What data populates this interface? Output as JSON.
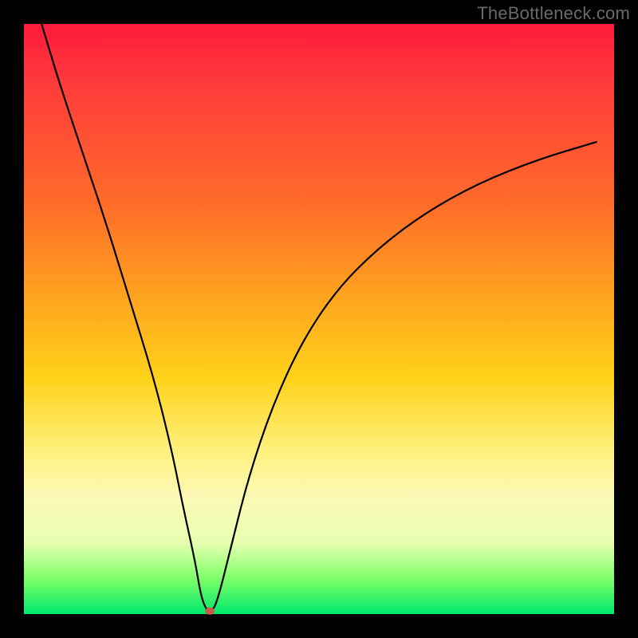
{
  "watermark": "TheBottleneck.com",
  "chart_data": {
    "type": "line",
    "title": "",
    "xlabel": "",
    "ylabel": "",
    "xlim": [
      0,
      100
    ],
    "ylim": [
      0,
      100
    ],
    "series": [
      {
        "name": "curve",
        "x": [
          3,
          6,
          10,
          14,
          18,
          22,
          25,
          27,
          29,
          30,
          31,
          32,
          33,
          35,
          38,
          42,
          47,
          53,
          60,
          68,
          77,
          87,
          97
        ],
        "y": [
          100,
          90,
          78,
          66,
          53,
          40,
          28,
          18,
          9,
          3,
          0.5,
          0.5,
          3,
          11,
          23,
          35,
          46,
          55,
          62,
          68,
          73,
          77,
          80
        ]
      }
    ],
    "marker": {
      "x": 31.5,
      "y": 0.5,
      "color": "#c95a4a"
    },
    "gradient_stops": [
      {
        "pos": 0,
        "color": "#ff1a3c"
      },
      {
        "pos": 30,
        "color": "#ff6a2a"
      },
      {
        "pos": 60,
        "color": "#ffd21a"
      },
      {
        "pos": 80,
        "color": "#fdf9b5"
      },
      {
        "pos": 100,
        "color": "#00e86b"
      }
    ]
  }
}
